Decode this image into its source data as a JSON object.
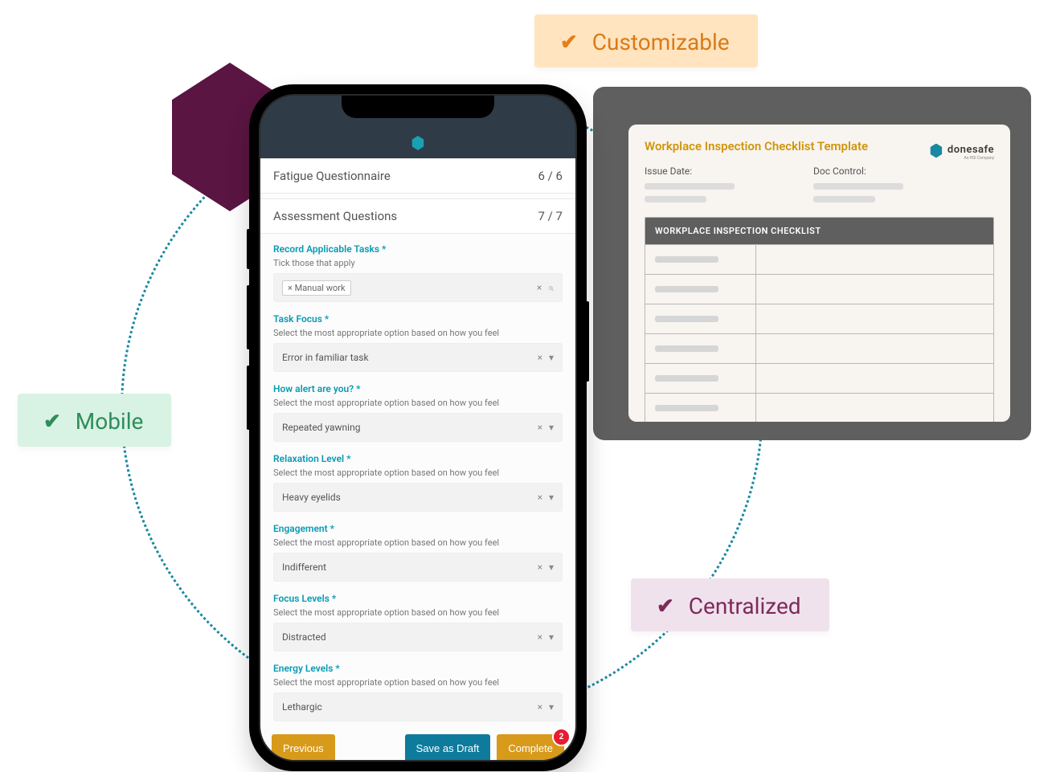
{
  "badges": {
    "customizable": "Customizable",
    "mobile": "Mobile",
    "centralized": "Centralized"
  },
  "checklist_panel": {
    "title": "Workplace Inspection Checklist Template",
    "issue_label": "Issue Date:",
    "doc_label": "Doc Control:",
    "logo_text": "donesafe",
    "logo_sub": "An HSI Company",
    "table_header": "WORKPLACE INSPECTION CHECKLIST"
  },
  "phone": {
    "section1": {
      "title": "Fatigue Questionnaire",
      "count": "6 / 6"
    },
    "section2": {
      "title": "Assessment Questions",
      "count": "7 / 7"
    },
    "q1": {
      "title": "Record Applicable Tasks *",
      "sub": "Tick those that apply",
      "tag": "× Manual work",
      "icon1": "×",
      "icon2_glyph": "⌕"
    },
    "select_sub": "Select the most appropriate option based on how you feel",
    "q2": {
      "title": "Task Focus *",
      "value": "Error in familiar task"
    },
    "q3": {
      "title": "How alert are you? *",
      "value": "Repeated yawning"
    },
    "q4": {
      "title": "Relaxation Level *",
      "value": "Heavy eyelids"
    },
    "q5": {
      "title": "Engagement *",
      "value": "Indifferent"
    },
    "q6": {
      "title": "Focus Levels *",
      "value": "Distracted"
    },
    "q7": {
      "title": "Energy Levels *",
      "value": "Lethargic"
    },
    "select_icons": {
      "x": "×",
      "caret": "▾"
    },
    "actions": {
      "previous": "Previous",
      "draft": "Save as Draft",
      "complete": "Complete",
      "notif": "2"
    }
  }
}
